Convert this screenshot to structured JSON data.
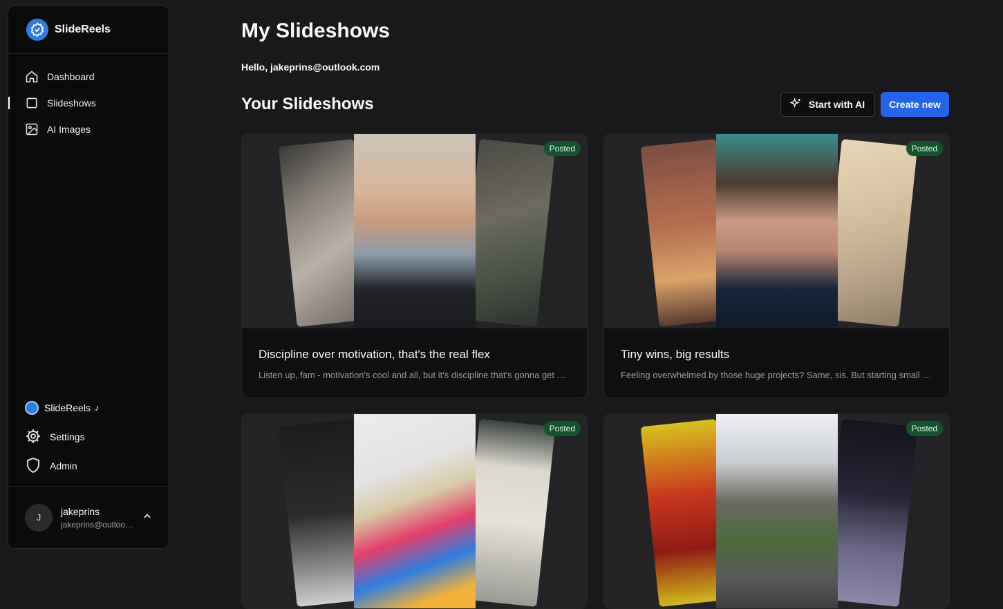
{
  "app": {
    "name": "SlideReels"
  },
  "nav": {
    "items": [
      {
        "label": "Dashboard",
        "icon": "home-icon"
      },
      {
        "label": "Slideshows",
        "icon": "square-icon"
      },
      {
        "label": "AI Images",
        "icon": "image-icon"
      }
    ]
  },
  "bottom_nav": {
    "account_label": "SlideReels",
    "settings_label": "Settings",
    "admin_label": "Admin"
  },
  "user": {
    "initial": "J",
    "name": "jakeprins",
    "email": "jakeprins@outlook.com"
  },
  "header": {
    "title": "My Slideshows",
    "greeting": "Hello, jakeprins@outlook.com",
    "section_title": "Your Slideshows",
    "ai_button": "Start with AI",
    "create_button": "Create new"
  },
  "cards": [
    {
      "badge": "Posted",
      "title": "Discipline over motivation, that's the real flex",
      "description": "Listen up, fam - motivation's cool and all, but it's discipline that's gonna get you places"
    },
    {
      "badge": "Posted",
      "title": "Tiny wins, big results",
      "description": "Feeling overwhelmed by those huge projects? Same, sis. But starting small is the move"
    },
    {
      "badge": "Posted",
      "title": "",
      "description": ""
    },
    {
      "badge": "Posted",
      "title": "",
      "description": ""
    }
  ],
  "colors": {
    "accent": "#2563eb",
    "posted_badge": "#14532d",
    "background": "#19191b",
    "sidebar": "#0b0b0c"
  }
}
